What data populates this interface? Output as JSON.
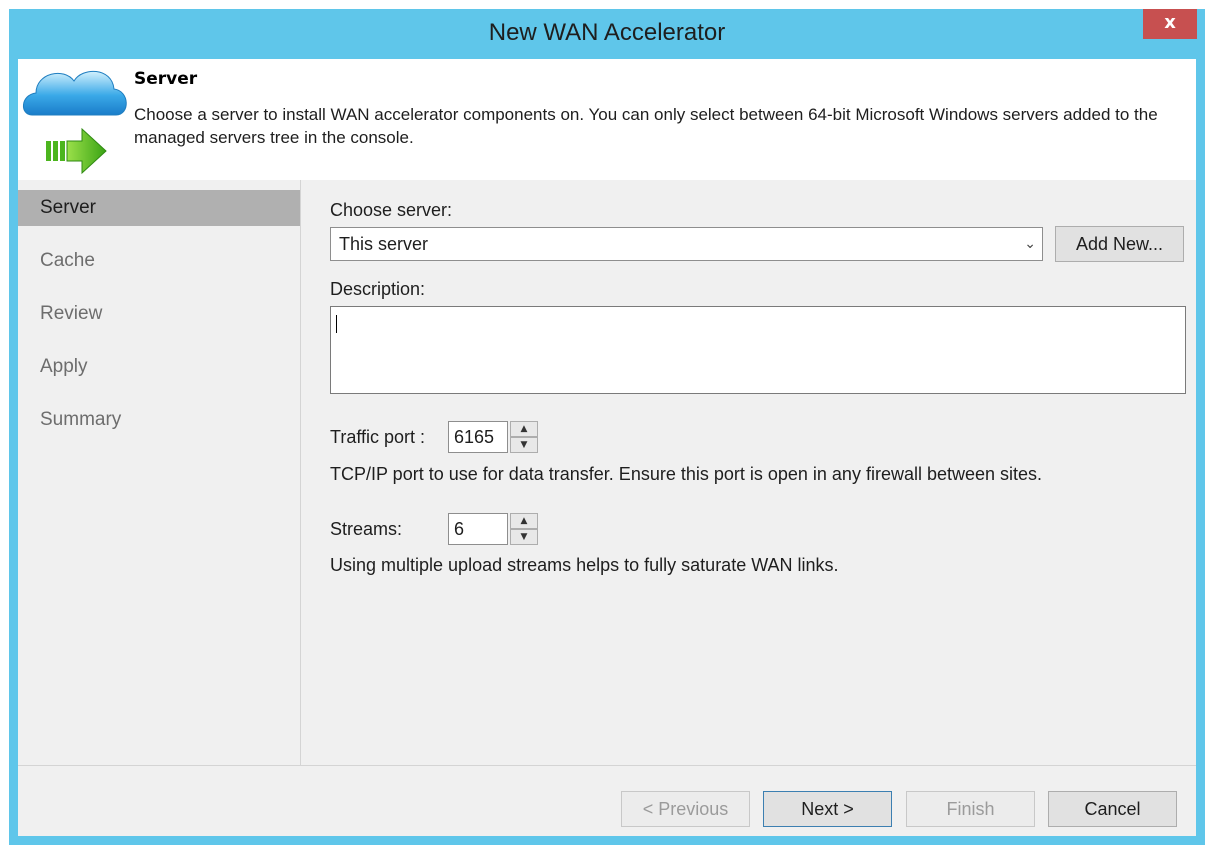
{
  "window": {
    "title": "New WAN Accelerator",
    "close_label": "x"
  },
  "header": {
    "step_title": "Server",
    "step_description": "Choose a server to install WAN accelerator components on. You can only select between 64-bit Microsoft Windows servers added to the managed servers tree in the console."
  },
  "sidebar": {
    "items": [
      {
        "label": "Server",
        "active": true
      },
      {
        "label": "Cache",
        "active": false
      },
      {
        "label": "Review",
        "active": false
      },
      {
        "label": "Apply",
        "active": false
      },
      {
        "label": "Summary",
        "active": false
      }
    ]
  },
  "form": {
    "choose_server_label": "Choose server:",
    "server_value": "This server",
    "add_new_label": "Add New...",
    "description_label": "Description:",
    "description_value": "",
    "traffic_port_label": "Traffic port :",
    "traffic_port_value": "6165",
    "traffic_port_help": "TCP/IP port to use for data transfer. Ensure this port is open in any firewall between sites.",
    "streams_label": "Streams:",
    "streams_value": "6",
    "streams_help": "Using multiple upload streams helps to fully saturate WAN links."
  },
  "footer": {
    "previous_label": "< Previous",
    "next_label": "Next >",
    "finish_label": "Finish",
    "cancel_label": "Cancel"
  },
  "colors": {
    "title_bar": "#5fc6ea",
    "close_button": "#c75050",
    "active_nav": "#b0b0b0",
    "body_background": "#f0f0f0"
  },
  "icons": [
    "cloud-icon",
    "arrow-right-icon",
    "chevron-down-icon",
    "spin-up-icon",
    "spin-down-icon"
  ]
}
